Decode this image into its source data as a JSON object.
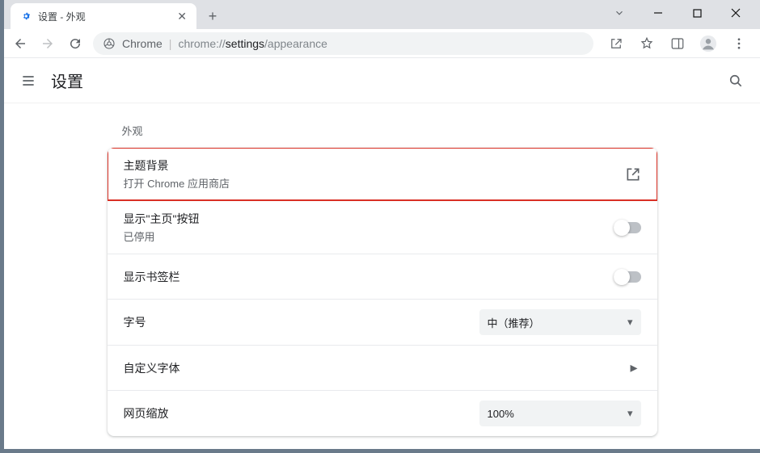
{
  "tab": {
    "title": "设置 - 外观"
  },
  "omnibox": {
    "origin_label": "Chrome",
    "url_prefix": "chrome://",
    "url_host": "settings",
    "url_path": "/appearance"
  },
  "settings": {
    "title": "设置",
    "section_label": "外观",
    "rows": {
      "theme": {
        "primary": "主题背景",
        "secondary": "打开 Chrome 应用商店"
      },
      "home_button": {
        "primary": "显示\"主页\"按钮",
        "secondary": "已停用"
      },
      "bookmarks_bar": {
        "primary": "显示书签栏"
      },
      "font_size": {
        "primary": "字号",
        "value": "中（推荐）"
      },
      "custom_fonts": {
        "primary": "自定义字体"
      },
      "page_zoom": {
        "primary": "网页缩放",
        "value": "100%"
      }
    }
  }
}
